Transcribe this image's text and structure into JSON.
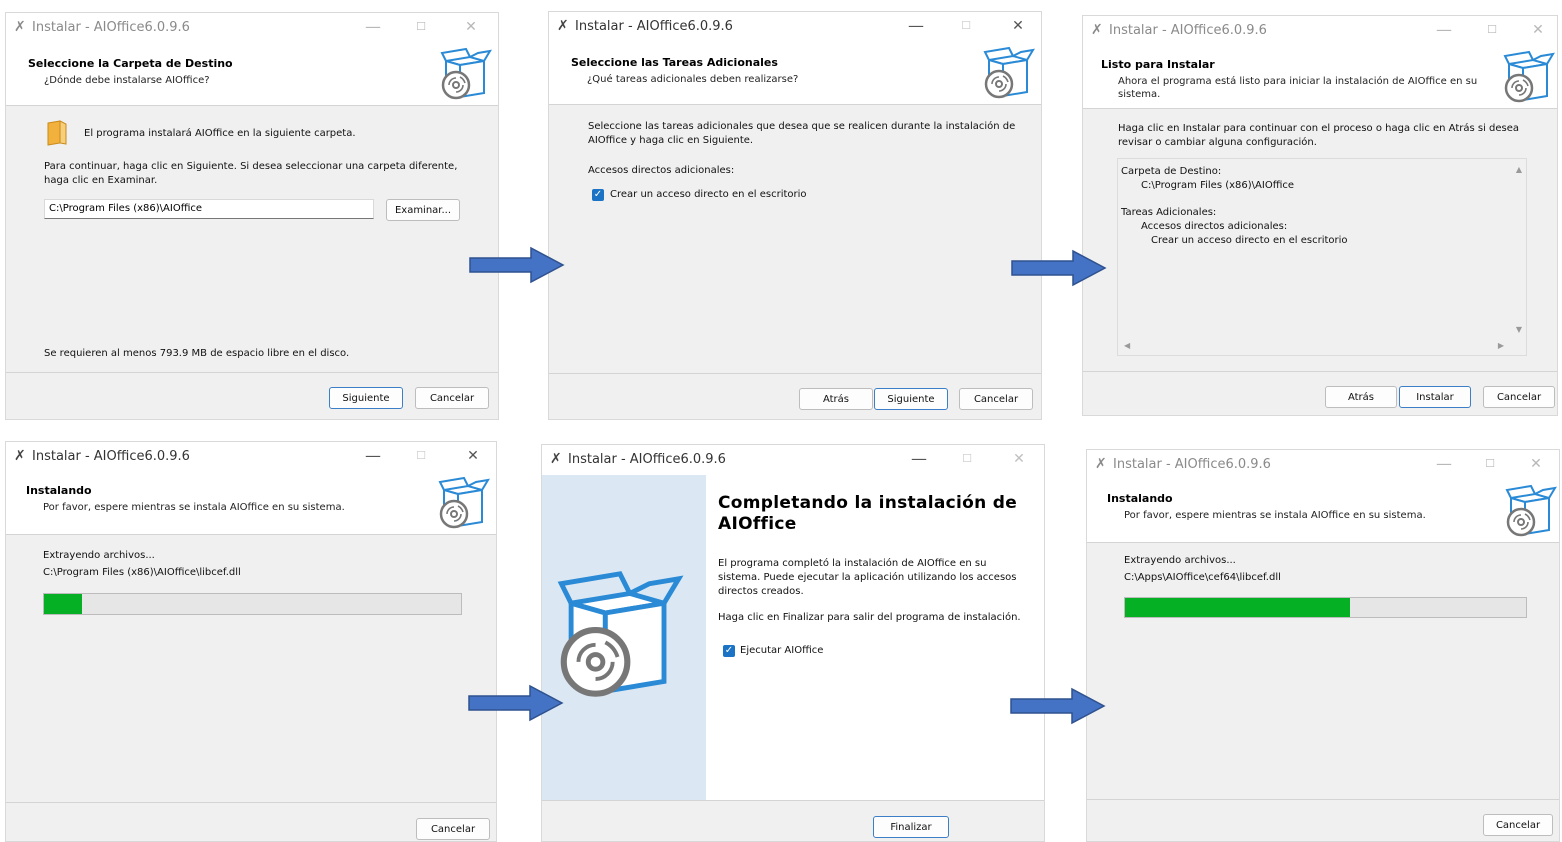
{
  "window_title": "Instalar - AIOffice6.0.9.6",
  "controls": {
    "minimize": "—",
    "maximize": "☐",
    "close": "✕",
    "app_icon": "✗"
  },
  "win1": {
    "header_title": "Seleccione la Carpeta de Destino",
    "header_subtitle": "¿Dónde debe instalarse AIOffice?",
    "intro": "El programa instalará AIOffice en la siguiente carpeta.",
    "instructions_line1": "Para continuar, haga clic en Siguiente. Si desea seleccionar una carpeta diferente,",
    "instructions_line2": "haga clic en Examinar.",
    "path_value": "C:\\Program Files (x86)\\AIOffice",
    "browse_label": "Examinar...",
    "disk_space": "Se requieren al menos 793.9 MB de espacio libre en el disco.",
    "next_label": "Siguiente",
    "cancel_label": "Cancelar"
  },
  "win2": {
    "header_title": "Seleccione las Tareas Adicionales",
    "header_subtitle": "¿Qué tareas adicionales deben realizarse?",
    "intro_line1": "Seleccione las tareas adicionales que desea que se realicen durante la instalación de",
    "intro_line2": "AIOffice y haga clic en Siguiente.",
    "group_label": "Accesos directos adicionales:",
    "checkbox_label": "Crear un acceso directo en el escritorio",
    "checkbox_checked": true,
    "back_label": "Atrás",
    "next_label": "Siguiente",
    "cancel_label": "Cancelar"
  },
  "win3": {
    "header_title": "Listo para Instalar",
    "header_subtitle_line1": "Ahora el programa está listo para iniciar la instalación de AIOffice en su",
    "header_subtitle_line2": "sistema.",
    "intro_line1": "Haga clic en Instalar para continuar con el proceso o haga clic en Atrás si desea",
    "intro_line2": "revisar o cambiar alguna configuración.",
    "summary": [
      "Carpeta de Destino:",
      "C:\\Program Files (x86)\\AIOffice",
      "Tareas Adicionales:",
      "Accesos directos adicionales:",
      "Crear un acceso directo en el escritorio"
    ],
    "back_label": "Atrás",
    "install_label": "Instalar",
    "cancel_label": "Cancelar"
  },
  "win4": {
    "header_title": "Instalando",
    "header_subtitle": "Por favor, espere mientras se instala AIOffice en su sistema.",
    "status": "Extrayendo archivos...",
    "file": "C:\\Program Files (x86)\\AIOffice\\libcef.dll",
    "progress": 0.09,
    "cancel_label": "Cancelar"
  },
  "win5": {
    "heading_line1": "Completando la instalación de",
    "heading_line2": "AIOffice",
    "text_line1": "El programa completó la instalación de AIOffice en su",
    "text_line2": "sistema. Puede ejecutar la aplicación utilizando los accesos",
    "text_line3": "directos creados.",
    "finish_hint": "Haga clic en Finalizar para salir del programa de instalación.",
    "checkbox_label": "Ejecutar AIOffice",
    "checkbox_checked": true,
    "finish_label": "Finalizar"
  },
  "win6": {
    "header_title": "Instalando",
    "header_subtitle": "Por favor, espere mientras se instala AIOffice en su sistema.",
    "status": "Extrayendo archivos...",
    "file": "C:\\Apps\\AIOffice\\cef64\\libcef.dll",
    "progress": 0.56,
    "cancel_label": "Cancelar"
  },
  "colors": {
    "arrow": "#4472c4",
    "progress": "#06b025",
    "accent": "#1a73c4"
  }
}
